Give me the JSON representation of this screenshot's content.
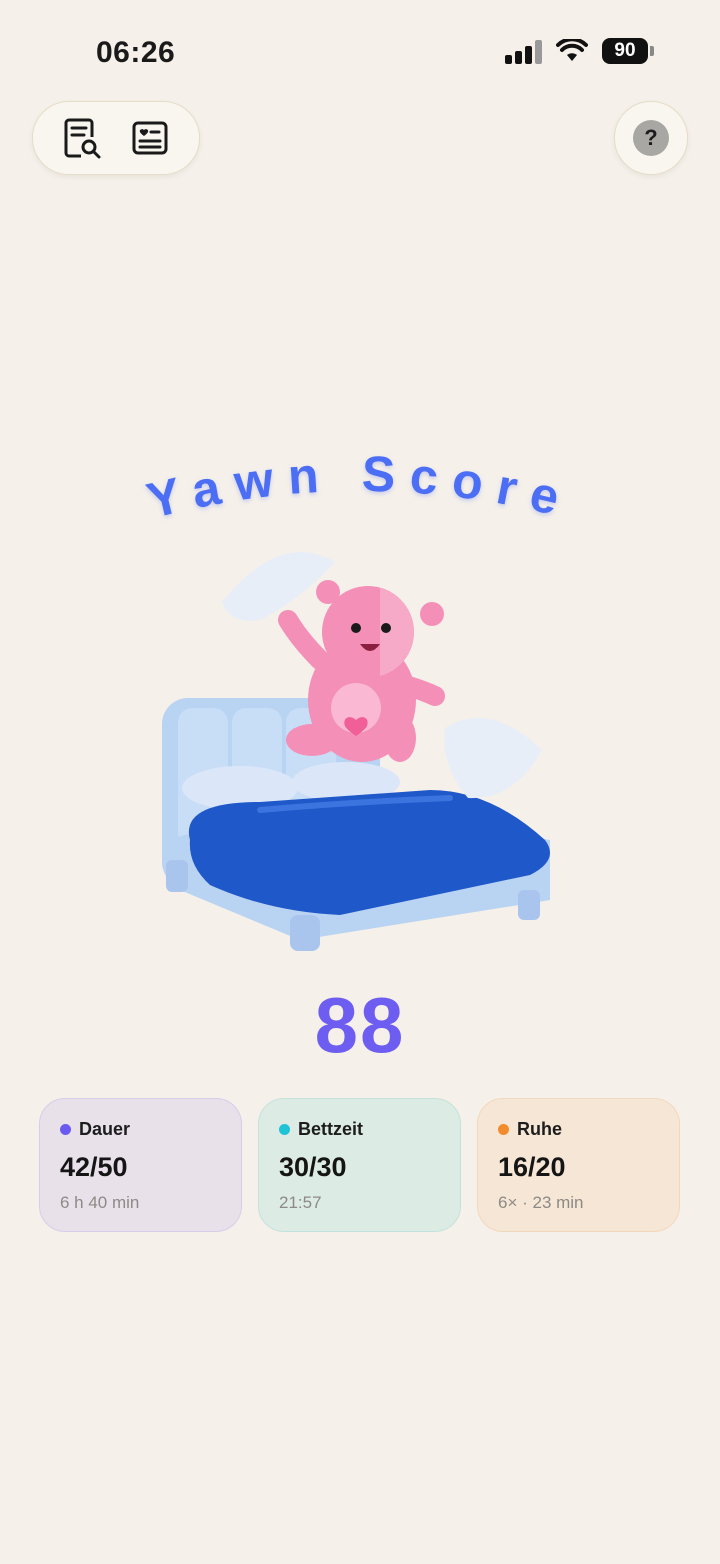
{
  "status": {
    "time": "06:26",
    "battery": "90"
  },
  "toolbar": {
    "report_icon": "document-search-icon",
    "journal_icon": "heart-card-icon",
    "help_label": "?"
  },
  "hero": {
    "title": "Yawn Score",
    "score": "88"
  },
  "cards": [
    {
      "label": "Dauer",
      "score": "42/50",
      "detail": "6 h 40 min",
      "color": "#6a5af0"
    },
    {
      "label": "Bettzeit",
      "score": "30/30",
      "detail": "21:57",
      "color": "#1ec3d6"
    },
    {
      "label": "Ruhe",
      "score": "16/20",
      "detail": "6× · 23 min",
      "color": "#f28b2c"
    }
  ],
  "colors": {
    "accent": "#6d5df0",
    "title_blue": "#4b6ef5",
    "background": "#f5f0e9"
  }
}
